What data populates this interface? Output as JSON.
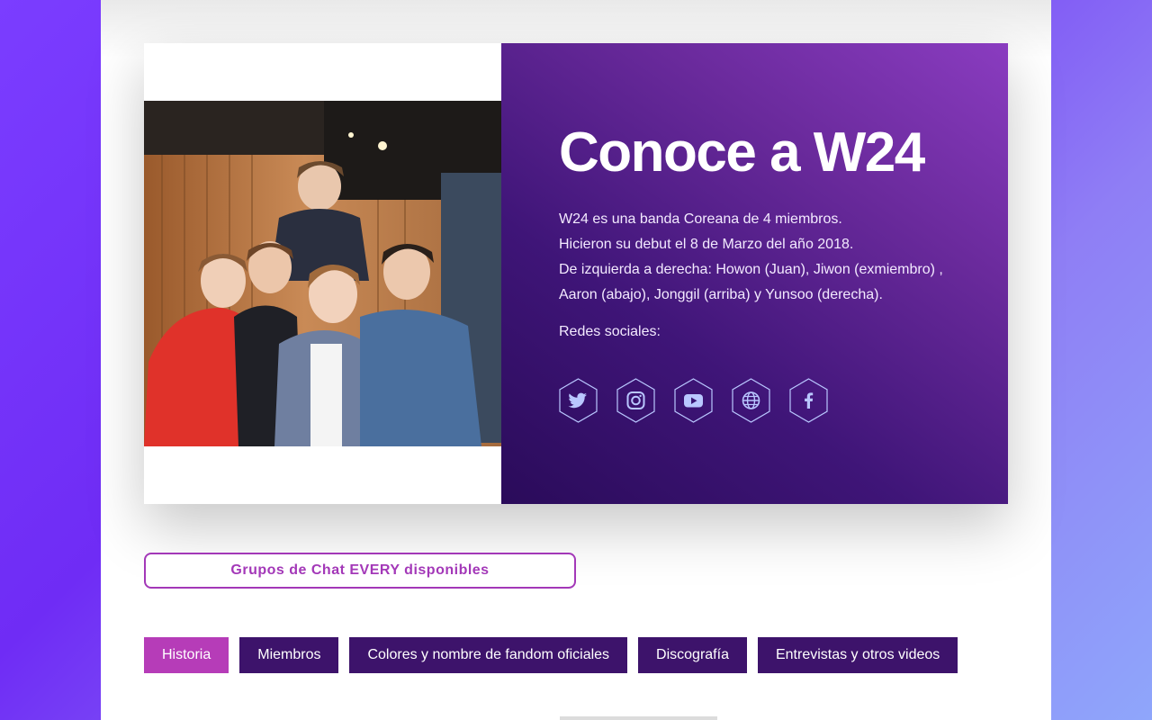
{
  "hero": {
    "title": "Conoce a W24",
    "description": [
      "W24 es una banda Coreana de 4 miembros.",
      "Hicieron su debut el 8 de Marzo del año 2018.",
      "De izquierda a derecha: Howon (Juan), Jiwon (exmiembro) ,",
      "Aaron (abajo), Jonggil (arriba) y Yunsoo (derecha)."
    ],
    "social_label": "Redes sociales:",
    "social_icons": [
      "twitter-icon",
      "instagram-icon",
      "youtube-icon",
      "globe-icon",
      "facebook-icon"
    ]
  },
  "chat_button": "Grupos de Chat EVERY disponibles",
  "tabs": [
    {
      "label": "Historia",
      "active": true
    },
    {
      "label": "Miembros",
      "active": false
    },
    {
      "label": "Colores y nombre de fandom oficiales",
      "active": false
    },
    {
      "label": "Discografía",
      "active": false
    },
    {
      "label": "Entrevistas y otros videos",
      "active": false
    }
  ],
  "colors": {
    "accent": "#a338b8",
    "tab_active": "#b63cb8",
    "tab_inactive": "#3d136b",
    "icon_stroke": "#b9c7ff"
  }
}
